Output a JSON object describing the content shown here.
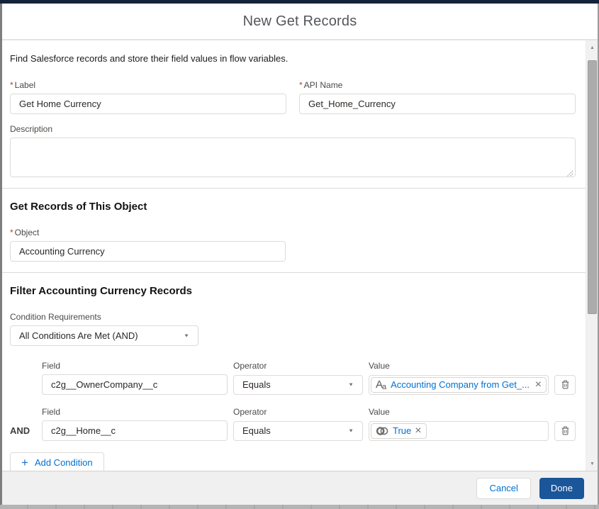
{
  "modal": {
    "title": "New Get Records",
    "intro": "Find Salesforce records and store their field values in flow variables.",
    "required_marker": "*",
    "label_field": {
      "label": "Label",
      "value": "Get Home Currency"
    },
    "api_name_field": {
      "label": "API Name",
      "value": "Get_Home_Currency"
    },
    "description_field": {
      "label": "Description",
      "value": ""
    },
    "object_section": {
      "heading": "Get Records of This Object",
      "object_field": {
        "label": "Object",
        "value": "Accounting Currency"
      }
    },
    "filter_section": {
      "heading": "Filter Accounting Currency Records",
      "condition_requirements": {
        "label": "Condition Requirements",
        "value": "All Conditions Are Met (AND)"
      },
      "columns": {
        "field": "Field",
        "operator": "Operator",
        "value": "Value"
      },
      "rows": [
        {
          "connector": "",
          "field": "c2g__OwnerCompany__c",
          "operator": "Equals",
          "value": "Accounting Company from Get_...",
          "value_type": "text"
        },
        {
          "connector": "AND",
          "field": "c2g__Home__c",
          "operator": "Equals",
          "value": "True",
          "value_type": "boolean"
        }
      ],
      "add_condition": "Add Condition"
    },
    "footer": {
      "cancel": "Cancel",
      "done": "Done"
    }
  },
  "icons": {
    "dropdown_arrow": "▼",
    "remove_x": "×",
    "add_plus": "+",
    "scroll_up": "▲",
    "scroll_down": "▼",
    "text_type_large": "A",
    "text_type_small": "a"
  },
  "colors": {
    "link_blue": "#0070d2",
    "done_button_blue": "#1a5699",
    "topbar_navy": "#15223b",
    "required_red": "#c23934",
    "border_gray": "#dddbda",
    "footer_gray": "#f0f0f0"
  }
}
